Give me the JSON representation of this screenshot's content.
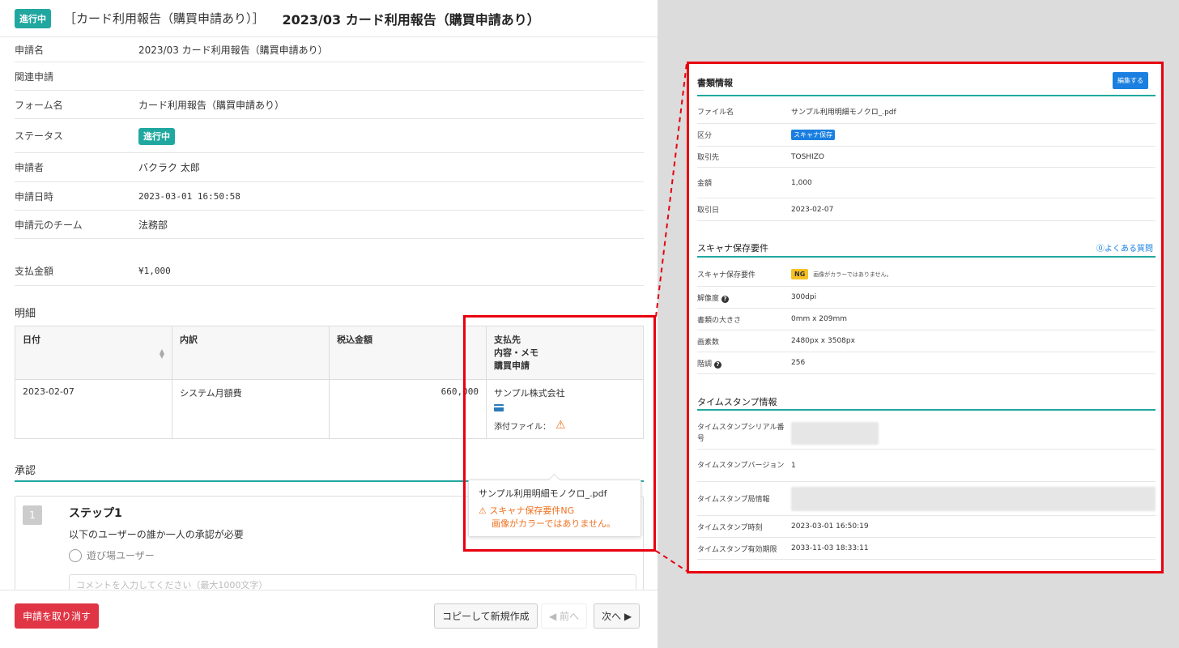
{
  "header": {
    "status_badge": "進行中",
    "bracket_title": "［カード利用報告（購買申請あり）］",
    "title": "2023/03 カード利用報告（購買申請あり）"
  },
  "info": {
    "rows": [
      {
        "label": "申請名",
        "value": "2023/03 カード利用報告（購買申請あり）"
      },
      {
        "label": "関連申請",
        "value": ""
      },
      {
        "label": "フォーム名",
        "value": "カード利用報告（購買申請あり）"
      },
      {
        "label": "ステータス",
        "value": "進行中"
      },
      {
        "label": "申請者",
        "value": "バクラク 太郎"
      },
      {
        "label": "申請日時",
        "value": "2023-03-01 16:50:58"
      },
      {
        "label": "申請元のチーム",
        "value": "法務部"
      },
      {
        "label": "支払金額",
        "value": "¥1,000"
      }
    ]
  },
  "meisai": {
    "heading": "明細",
    "columns": [
      "日付",
      "内訳",
      "税込金額",
      "支払先",
      "内容・メモ",
      "購買申請"
    ],
    "row": {
      "date": "2023-02-07",
      "item": "システム月額費",
      "amount": "660,000",
      "payee": "サンプル株式会社",
      "attach_label": "添付ファイル："
    }
  },
  "approval": {
    "heading": "承認",
    "step_num": "1",
    "step_title": "ステップ1",
    "step_desc": "以下のユーザーの誰か一人の承認が必要",
    "user": "遊び場ユーザー",
    "comment_placeholder": "コメントを入力してください（最大1000文字）"
  },
  "tooltip": {
    "file": "サンプル利用明細モノクロ_.pdf",
    "warn": "スキャナ保存要件NG",
    "warn_detail": "画像がカラーではありません。"
  },
  "footer": {
    "cancel": "申請を取り消す",
    "copy": "コピーして新規作成",
    "prev": "◀ 前へ",
    "next": "次へ ▶"
  },
  "doc_info": {
    "heading": "書類情報",
    "edit": "編集する",
    "rows": [
      {
        "label": "ファイル名",
        "value": "サンプル利用明細モノクロ_.pdf"
      },
      {
        "label": "区分",
        "value": "スキャナ保存"
      },
      {
        "label": "取引先",
        "value": "TOSHIZO"
      },
      {
        "label": "金額",
        "value": "1,000"
      },
      {
        "label": "取引日",
        "value": "2023-02-07"
      }
    ]
  },
  "scanner": {
    "heading": "スキャナ保存要件",
    "faq": "よくある質問",
    "ng": "NG",
    "ng_msg": "画像がカラーではありません。",
    "rows": [
      {
        "label": "スキャナ保存要件",
        "value": ""
      },
      {
        "label": "解像度",
        "value": "300dpi"
      },
      {
        "label": "書類の大きさ",
        "value": "0mm x 209mm"
      },
      {
        "label": "画素数",
        "value": "2480px x 3508px"
      },
      {
        "label": "階調",
        "value": "256"
      }
    ]
  },
  "timestamp": {
    "heading": "タイムスタンプ情報",
    "rows": [
      {
        "label": "タイムスタンプシリアル番号",
        "value": ""
      },
      {
        "label": "タイムスタンプバージョン",
        "value": "1"
      },
      {
        "label": "タイムスタンプ局情報",
        "value": ""
      },
      {
        "label": "タイムスタンプ時刻",
        "value": "2023-03-01 16:50:19"
      },
      {
        "label": "タイムスタンプ有効期限",
        "value": "2033-11-03 18:33:11"
      }
    ]
  },
  "colors": {
    "accent": "#20a8a0",
    "highlight": "#e8000f",
    "primary": "#1a7fe0",
    "danger": "#e03545",
    "warning": "#f07020"
  }
}
